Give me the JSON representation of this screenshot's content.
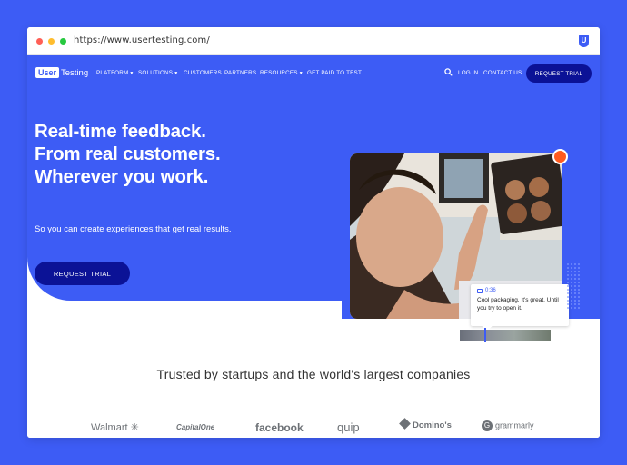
{
  "browser": {
    "url": "https://www.usertesting.com/",
    "extension_letter": "U"
  },
  "nav": {
    "logo_user": "User",
    "logo_testing": "Testing",
    "items": [
      "PLATFORM",
      "SOLUTIONS",
      "CUSTOMERS",
      "PARTNERS",
      "RESOURCES",
      "GET PAID TO TEST"
    ],
    "log_in": "LOG IN",
    "contact": "CONTACT US",
    "request_trial": "REQUEST TRIAL"
  },
  "hero": {
    "line1": "Real-time feedback.",
    "line2": "From real customers.",
    "line3": "Wherever you work.",
    "subtitle": "So you can create experiences that get real results.",
    "cta": "REQUEST TRIAL"
  },
  "video": {
    "timestamp": "0:36",
    "caption": "Cool packaging. It's great. Until you try to open it."
  },
  "trusted": {
    "heading": "Trusted by startups and the world's largest companies",
    "logos": [
      "Walmart",
      "CapitalOne",
      "facebook",
      "quip",
      "Domino's",
      "grammarly"
    ]
  },
  "colors": {
    "brand_blue": "#3d5cf5",
    "button_navy": "#0b1296",
    "accent_orange": "#ff5a1f"
  },
  "icons": [
    "search-icon",
    "cookie-icon",
    "video-icon",
    "walmart-spark-icon",
    "dominos-icon",
    "grammarly-icon"
  ]
}
